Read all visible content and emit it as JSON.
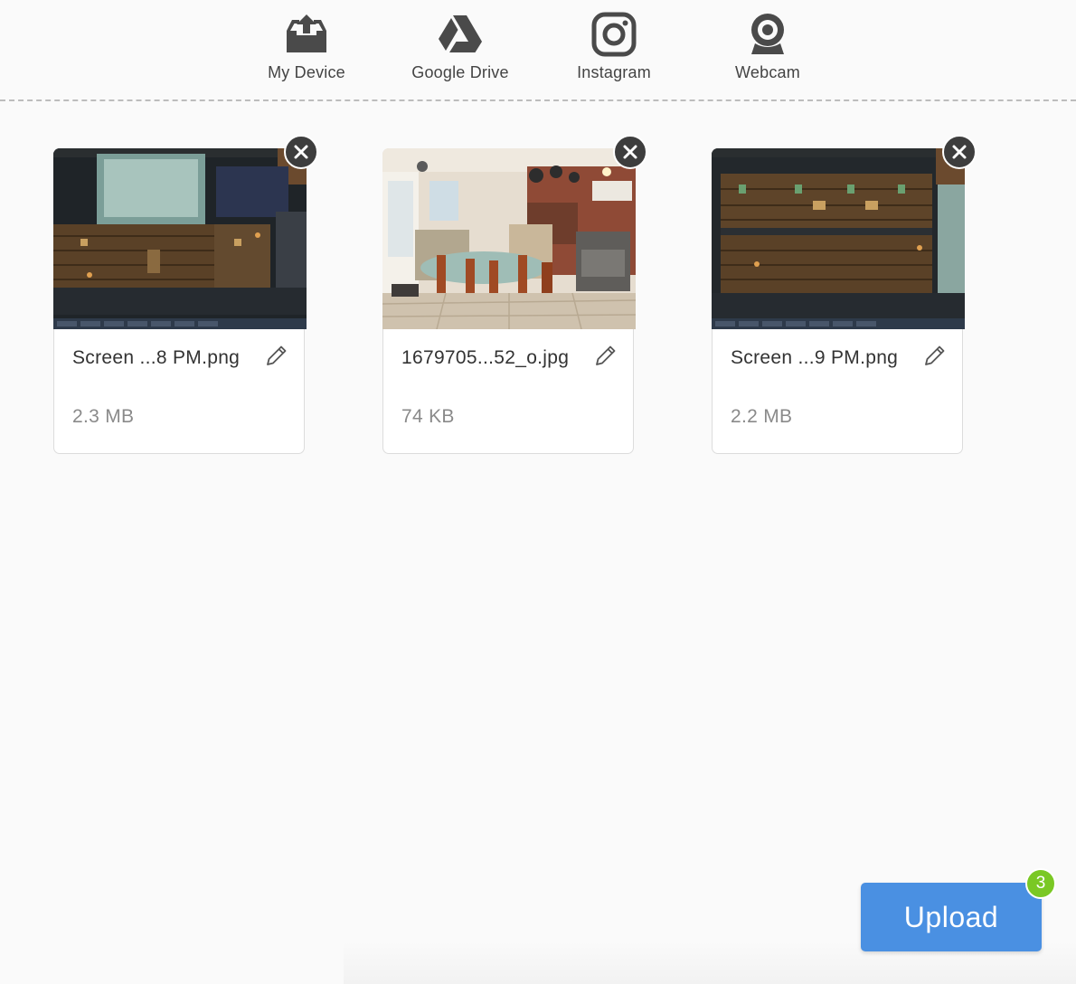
{
  "sources": [
    {
      "label": "My Device",
      "icon": "upload-tray-icon"
    },
    {
      "label": "Google Drive",
      "icon": "google-drive-icon"
    },
    {
      "label": "Instagram",
      "icon": "instagram-icon"
    },
    {
      "label": "Webcam",
      "icon": "webcam-icon"
    }
  ],
  "files": [
    {
      "name": "Screen ...8 PM.png",
      "size": "2.3 MB",
      "thumbnail": "game-screenshot"
    },
    {
      "name": "1679705...52_o.jpg",
      "size": "74 KB",
      "thumbnail": "kitchen-photo"
    },
    {
      "name": "Screen ...9 PM.png",
      "size": "2.2 MB",
      "thumbnail": "game-screenshot"
    }
  ],
  "upload": {
    "label": "Upload",
    "count": "3"
  },
  "colors": {
    "accent": "#4a90e2",
    "badge": "#7ac824",
    "remove": "#3d3d3d",
    "icon": "#4a4a4a"
  }
}
